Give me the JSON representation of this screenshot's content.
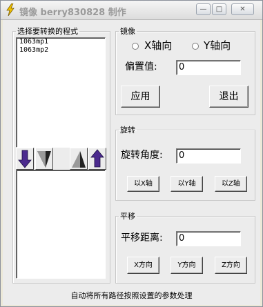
{
  "window": {
    "title": "镜像 berry830828 制作",
    "minimize_glyph": "—",
    "maximize_glyph": "□",
    "close_glyph": "✕"
  },
  "program_list": {
    "label": "选择要转换的程式",
    "items": [
      "1063mp1",
      "1063mp2"
    ],
    "buttons": [
      "arrow-down-icon",
      "triangle-left-icon",
      "triangle-right-icon",
      "arrow-up-icon"
    ]
  },
  "mirror": {
    "title": "镜像",
    "radio_x": "X轴向",
    "radio_y": "Y轴向",
    "offset_label": "偏置值:",
    "offset_value": "0",
    "apply_label": "应用",
    "exit_label": "退出"
  },
  "rotate": {
    "title": "旋转",
    "angle_label": "旋转角度:",
    "angle_value": "0",
    "btn_x": "以X轴",
    "btn_y": "以Y轴",
    "btn_z": "以Z轴"
  },
  "translate": {
    "title": "平移",
    "distance_label": "平移距离:",
    "distance_value": "0",
    "btn_x": "X方向",
    "btn_y": "Y方向",
    "btn_z": "Z方向"
  },
  "status_text": "自动将所有路径按照设置的参数处理",
  "colors": {
    "arrow": "#4b2a8e",
    "title_text": "#9a9a9a",
    "background": "#ececec"
  }
}
